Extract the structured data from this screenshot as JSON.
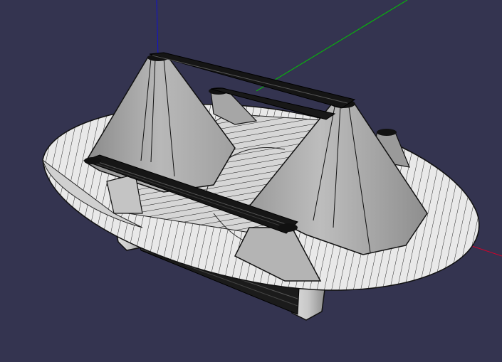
{
  "viewport": {
    "background": "#343450",
    "axes": {
      "x_color": "#d4002a",
      "y_color": "#00c800",
      "z_color": "#1010d0"
    },
    "model": {
      "surface_color": "#808080",
      "highlight_color": "#f0f0f0",
      "edge_color": "#111111"
    }
  }
}
